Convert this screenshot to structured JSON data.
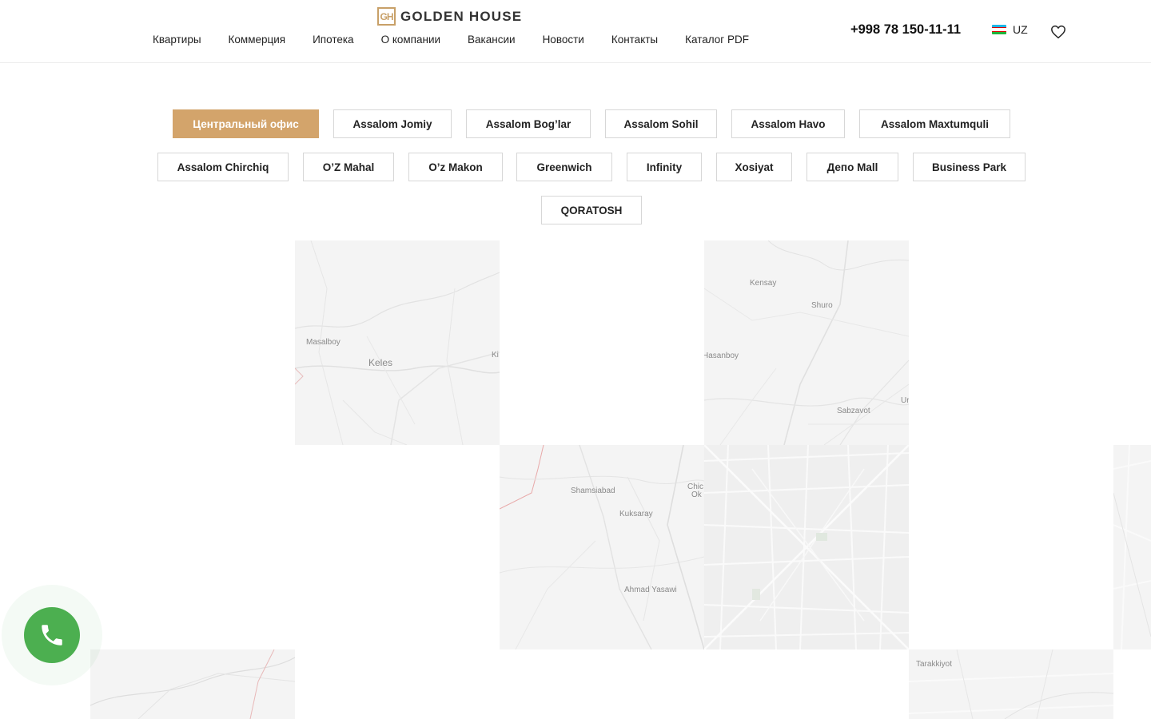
{
  "header": {
    "logo_mark": "GH",
    "logo_text": "GOLDEN HOUSE",
    "nav": [
      "Квартиры",
      "Коммерция",
      "Ипотека",
      "О компании",
      "Вакансии",
      "Новости",
      "Контакты",
      "Каталог PDF"
    ],
    "phone": "+998 78 150-11-11",
    "lang": "UZ"
  },
  "filters": {
    "row1": [
      "Центральный офис",
      "Assalom Jomiy",
      "Assalom Bog’lar",
      "Assalom Sohil",
      "Assalom Havo",
      "Assalom Maxtumquli"
    ],
    "row2": [
      "Assalom Chirchiq",
      "O’Z Mahal",
      "O’z Makon",
      "Greenwich",
      "Infinity",
      "Xosiyat",
      "Депо Mall",
      "Business Park"
    ],
    "row3": [
      "QORATOSH"
    ],
    "active": "Центральный офис"
  },
  "map": {
    "labels": {
      "masalboy": "Masalboy",
      "keles": "Keles",
      "ki": "Ki",
      "kensay": "Kensay",
      "shuro": "Shuro",
      "hasanboy": "Hasanboy",
      "ur": "Ur",
      "sabzavot": "Sabzavot",
      "shamsiabad": "Shamsiabad",
      "kuksaray": "Kuksaray",
      "chic": "Chic",
      "ok": "Ok",
      "ahmad_yasawi": "Ahmad Yasawi",
      "tarakkiyot": "Tarakkiyot"
    }
  },
  "colors": {
    "accent": "#d3a46b",
    "call": "#4caf50",
    "map_bg": "#f4f4f4"
  },
  "icons": {
    "phone": "phone-icon",
    "favorite": "heart-icon",
    "flag": "uz-flag-icon"
  }
}
